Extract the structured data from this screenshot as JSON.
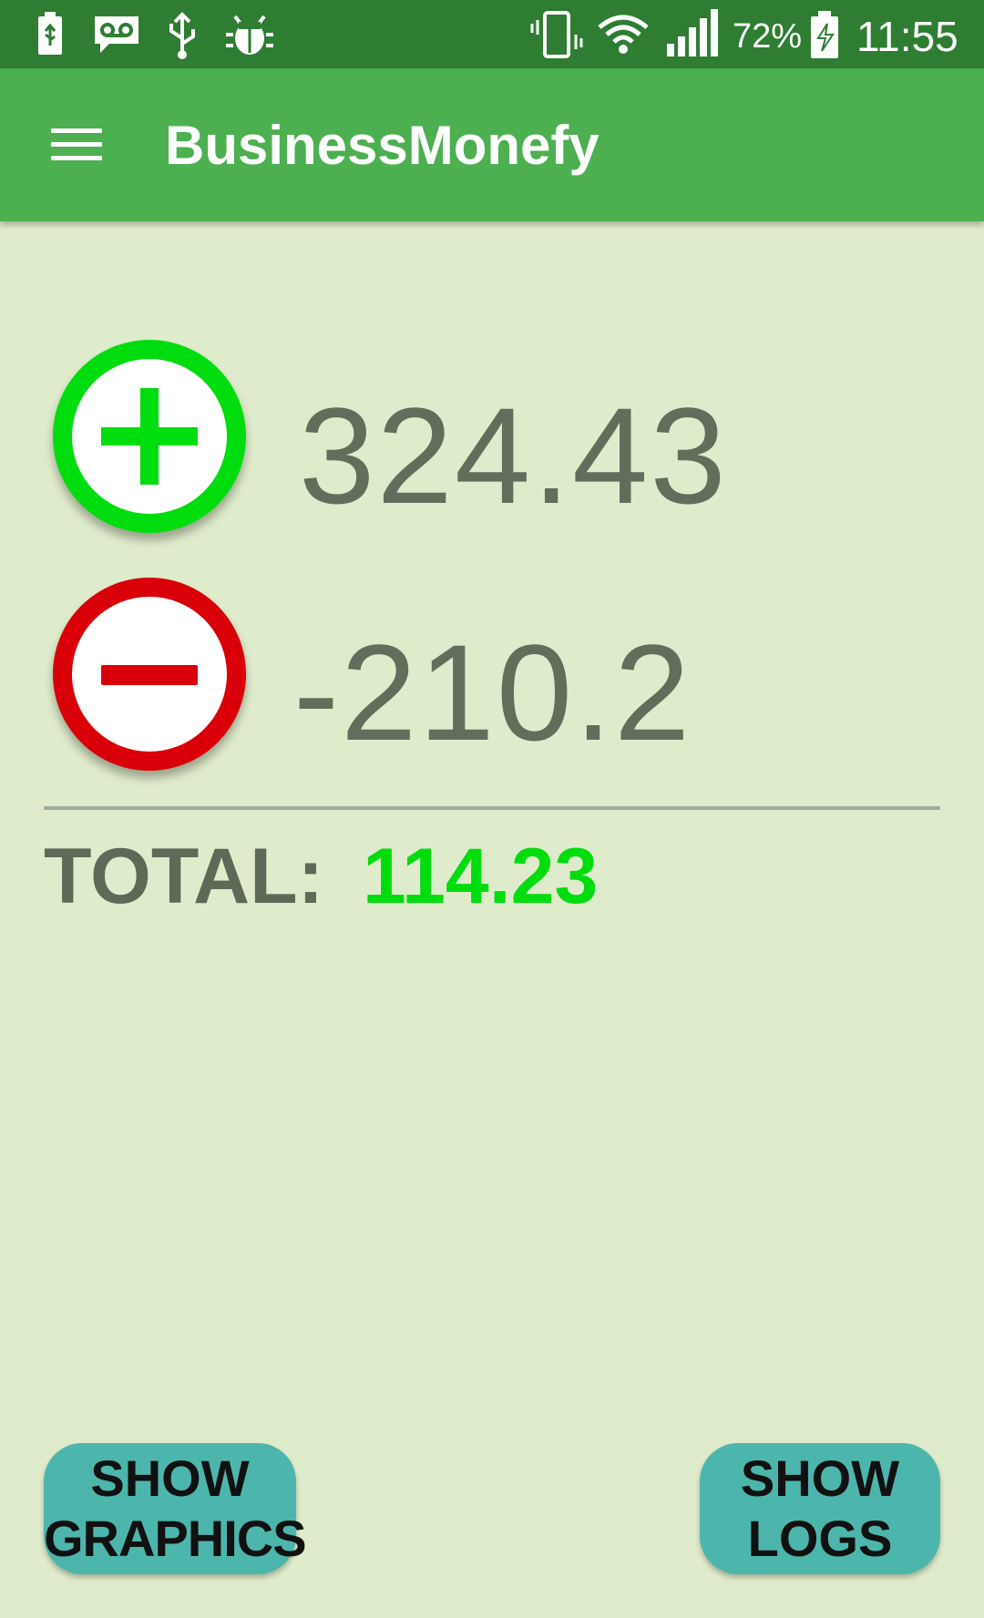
{
  "status_bar": {
    "icons": [
      "battery-usb-icon",
      "voicemail-icon",
      "usb-icon",
      "bug-icon",
      "vibrate-icon",
      "wifi-icon",
      "signal-icon",
      "battery-charging-icon"
    ],
    "battery_percent": "72%",
    "time": "11:55"
  },
  "app_bar": {
    "menu_icon": "hamburger-menu-icon",
    "title": "BusinessMonefy"
  },
  "summary": {
    "income_icon": "plus-circle-icon",
    "income_amount": "324.43",
    "income_color": "#00dd0e",
    "expense_icon": "minus-circle-icon",
    "expense_amount": "-210.2",
    "expense_color": "#d90009",
    "total_label": "TOTAL:",
    "total_value": "114.23",
    "total_color": "#00dd0e"
  },
  "actions": {
    "graphics_line1": "SHOW",
    "graphics_line2": "GRAPHICS",
    "logs_line1": "SHOW",
    "logs_line2": "LOGS",
    "button_color": "#4db6ac"
  },
  "colors": {
    "status_bar": "#2e7d32",
    "app_bar": "#4caf50",
    "background": "#dfeccb"
  }
}
